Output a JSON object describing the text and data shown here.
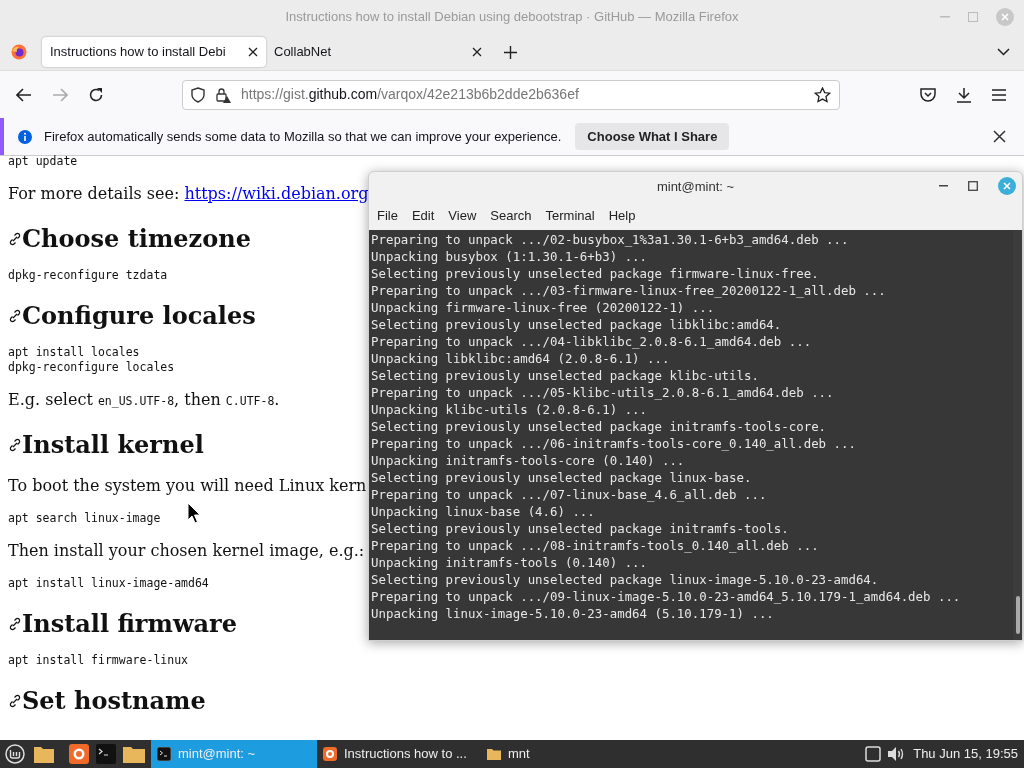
{
  "window": {
    "title": "Instructions how to install Debian using debootstrap · GitHub — Mozilla Firefox"
  },
  "tabs": [
    {
      "label": "Instructions how to install Debi",
      "selected": true
    },
    {
      "label": "CollabNet",
      "selected": false
    }
  ],
  "address_bar": {
    "prefix": "https://gist.",
    "domain": "github.com",
    "path": "/varqox/42e213b6b2dde2b636ef"
  },
  "notification": {
    "message": "Firefox automatically sends some data to Mozilla so that we can improve your experience.",
    "button": "Choose What I Share"
  },
  "page": [
    {
      "kind": "code",
      "text": "apt update"
    },
    {
      "kind": "link_paragraph",
      "text": "For more details see:",
      "link": "https://wiki.debian.org"
    },
    {
      "kind": "heading",
      "text": "Choose timezone"
    },
    {
      "kind": "code",
      "text": "dpkg-reconfigure tzdata"
    },
    {
      "kind": "heading",
      "text": "Configure locales"
    },
    {
      "kind": "code",
      "text": "apt install locales\ndpkg-reconfigure locales"
    },
    {
      "kind": "mixed",
      "parts": [
        {
          "text": "E.g. select ",
          "code": false
        },
        {
          "text": "en_US.UTF-8",
          "code": true
        },
        {
          "text": ", then ",
          "code": false
        },
        {
          "text": "C.UTF-8",
          "code": true
        },
        {
          "text": ".",
          "code": false
        }
      ]
    },
    {
      "kind": "heading",
      "text": "Install kernel"
    },
    {
      "kind": "paragraph",
      "text": "To boot the system you will need Linux kern"
    },
    {
      "kind": "code",
      "text": "apt search linux-image"
    },
    {
      "kind": "paragraph",
      "text": "Then install your chosen kernel image, e.g.:"
    },
    {
      "kind": "code",
      "text": "apt install linux-image-amd64"
    },
    {
      "kind": "heading",
      "text": "Install firmware"
    },
    {
      "kind": "code",
      "text": "apt install firmware-linux"
    },
    {
      "kind": "heading",
      "text": "Set hostname"
    }
  ],
  "terminal": {
    "title": "mint@mint: ~",
    "menu": [
      "File",
      "Edit",
      "View",
      "Search",
      "Terminal",
      "Help"
    ],
    "lines": [
      "Preparing to unpack .../02-busybox_1%3a1.30.1-6+b3_amd64.deb ...",
      "Unpacking busybox (1:1.30.1-6+b3) ...",
      "Selecting previously unselected package firmware-linux-free.",
      "Preparing to unpack .../03-firmware-linux-free_20200122-1_all.deb ...",
      "Unpacking firmware-linux-free (20200122-1) ...",
      "Selecting previously unselected package libklibc:amd64.",
      "Preparing to unpack .../04-libklibc_2.0.8-6.1_amd64.deb ...",
      "Unpacking libklibc:amd64 (2.0.8-6.1) ...",
      "Selecting previously unselected package klibc-utils.",
      "Preparing to unpack .../05-klibc-utils_2.0.8-6.1_amd64.deb ...",
      "Unpacking klibc-utils (2.0.8-6.1) ...",
      "Selecting previously unselected package initramfs-tools-core.",
      "Preparing to unpack .../06-initramfs-tools-core_0.140_all.deb ...",
      "Unpacking initramfs-tools-core (0.140) ...",
      "Selecting previously unselected package linux-base.",
      "Preparing to unpack .../07-linux-base_4.6_all.deb ...",
      "Unpacking linux-base (4.6) ...",
      "Selecting previously unselected package initramfs-tools.",
      "Preparing to unpack .../08-initramfs-tools_0.140_all.deb ...",
      "Unpacking initramfs-tools (0.140) ...",
      "Selecting previously unselected package linux-image-5.10.0-23-amd64.",
      "Preparing to unpack .../09-linux-image-5.10.0-23-amd64_5.10.179-1_amd64.deb ...",
      "Unpacking linux-image-5.10.0-23-amd64 (5.10.179-1) ..."
    ]
  },
  "taskbar": {
    "windows": [
      {
        "kind": "terminal",
        "label": "mint@mint: ~",
        "selected": true
      },
      {
        "kind": "firefox",
        "label": "Instructions how to ...",
        "selected": false
      },
      {
        "kind": "folder",
        "label": "mnt",
        "selected": false
      }
    ],
    "clock": "Thu Jun 15, 19:55"
  }
}
